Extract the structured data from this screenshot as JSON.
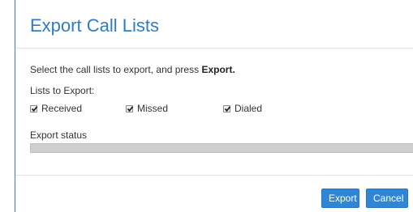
{
  "dialog": {
    "title": "Export Call Lists",
    "instructions_prefix": "Select the call lists to export, and press ",
    "instructions_bold": "Export.",
    "lists_label": "Lists to Export:",
    "options": [
      {
        "label": "Received",
        "checked": true
      },
      {
        "label": "Missed",
        "checked": true
      },
      {
        "label": "Dialed",
        "checked": true
      }
    ],
    "status_label": "Export status",
    "progress_fraction": 0
  },
  "buttons": {
    "export_label": "Export",
    "cancel_label": "Cancel"
  },
  "colors": {
    "accent": "#2f7cc6",
    "button_bg": "#2f86d6",
    "progress_track": "#cfcfcf"
  }
}
